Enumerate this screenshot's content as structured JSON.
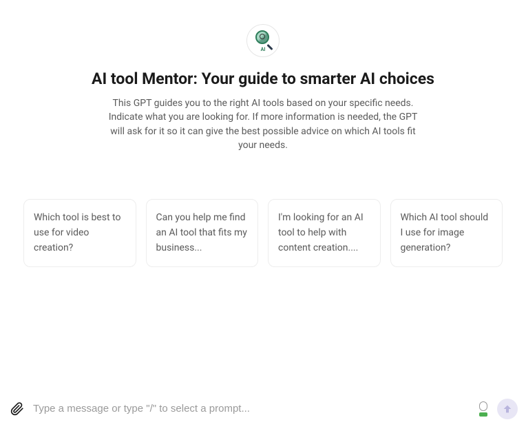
{
  "header": {
    "title": "AI tool Mentor: Your guide to smarter AI choices",
    "description": "This GPT guides you to the right AI tools based on your specific needs. Indicate what you are looking for. If more information is needed, the GPT will ask for it so it can give the best possible advice on which AI tools fit your needs.",
    "avatar_label": "AI"
  },
  "suggestions": [
    {
      "text": "Which tool is best to use for video creation?"
    },
    {
      "text": "Can you help me find an AI tool that fits my business..."
    },
    {
      "text": "I'm looking for an AI tool to help with content creation...."
    },
    {
      "text": "Which AI tool should I use for image generation?"
    }
  ],
  "input": {
    "placeholder": "Type a message or type \"/\" to select a prompt..."
  }
}
